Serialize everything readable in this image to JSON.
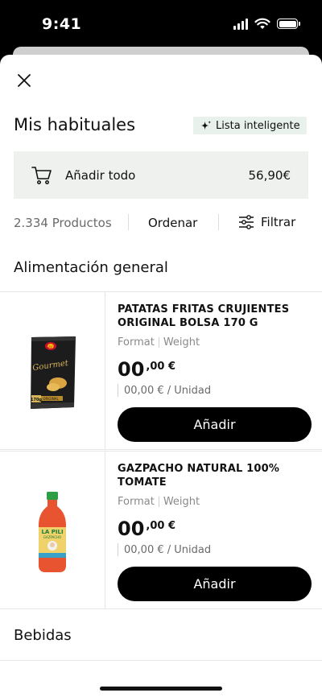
{
  "status_bar": {
    "time": "9:41"
  },
  "header": {
    "title": "Mis habituales",
    "smart_list_label": "Lista inteligente"
  },
  "add_all": {
    "label": "Añadir todo",
    "total": "56,90€"
  },
  "toolbar": {
    "count": "2.334 Productos",
    "sort_label": "Ordenar",
    "filter_label": "Filtrar"
  },
  "sections": [
    {
      "title": "Alimentación general"
    },
    {
      "title": "Bebidas"
    }
  ],
  "products": [
    {
      "name": "PATATAS FRITAS CRUJIENTES ORIGINAL BOLSA 170 G",
      "format_label": "Format",
      "weight_label": "Weight",
      "price_int": "00",
      "price_dec": ",00 €",
      "unit_price": "00,00 € / Unidad",
      "add_label": "Añadir",
      "image_text": {
        "brand": "Lay's",
        "line": "Gourmet",
        "variant": "ORIGINAL",
        "size": "170g"
      }
    },
    {
      "name": "GAZPACHO NATURAL 100% TOMATE",
      "format_label": "Format",
      "weight_label": "Weight",
      "price_int": "00",
      "price_dec": ",00 €",
      "unit_price": "00,00 € / Unidad",
      "add_label": "Añadir",
      "image_text": {
        "brand": "LA PILI",
        "line": "GAZPACHO"
      }
    }
  ],
  "colors": {
    "accent_bg": "#e8f1ec",
    "panel_bg": "#eff1ef",
    "button": "#000000"
  }
}
